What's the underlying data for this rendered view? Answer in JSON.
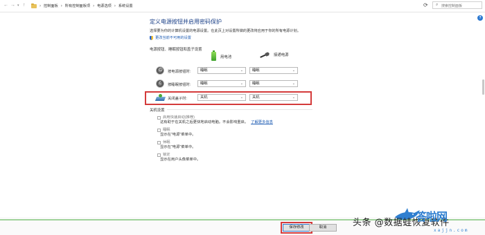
{
  "addressbar": {
    "breadcrumbs": [
      "控制面板",
      "所有控制面板项",
      "电源选项",
      "系统设置"
    ],
    "search_placeholder": "搜索控制面板"
  },
  "page": {
    "title": "定义电源按钮并启用密码保护",
    "description": "选择要为你的计算机设置的电源设置。在此页上对设置所做的更改将应用于你的所有电源计划。",
    "shield_link": "更改当前不可用的设置",
    "section_buttons": "电源按钮、睡眠按钮和盖子设置",
    "col_battery": "用电池",
    "col_plugged": "接通电源",
    "rows": [
      {
        "label": "按电源按钮时:",
        "battery": "睡眠",
        "plugged": "睡眠"
      },
      {
        "label": "按睡眠按钮时:",
        "battery": "睡眠",
        "plugged": "睡眠"
      },
      {
        "label": "关闭盖子时:",
        "battery": "关机",
        "plugged": "关机"
      }
    ],
    "section_shutdown": "关机设置",
    "options": [
      {
        "title": "启用快速启动(推荐)",
        "desc": "这有助于在关机之后更快地启动电脑。不会影响重启。",
        "link": "了解更多信息"
      },
      {
        "title": "睡眠",
        "desc": "显示在\"电源\"菜单中。"
      },
      {
        "title": "休眠",
        "desc": "显示在\"电源\"菜单中。"
      },
      {
        "title": "锁定",
        "desc": "显示在用户头像菜单中。"
      }
    ]
  },
  "footer": {
    "save_label": "保存修改",
    "cancel_label": "取消"
  },
  "watermark": {
    "text": "头条 @数据蛙恢复软件",
    "logo": "答啦网",
    "url": "xajjn.com"
  },
  "colors": {
    "title": "#1a3f87",
    "link": "#1e5cb3",
    "highlight": "#d43a3a"
  }
}
